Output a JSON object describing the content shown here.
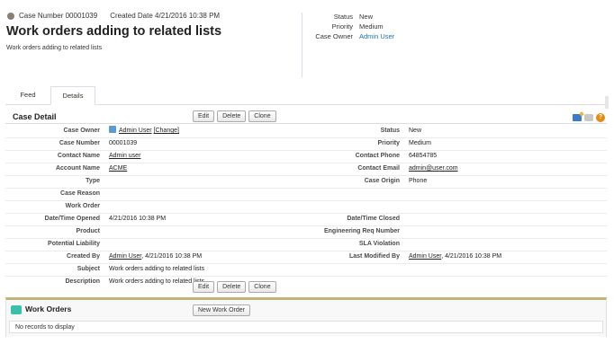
{
  "header": {
    "case_number_label": "Case Number",
    "case_number": "00001039",
    "created_date_label": "Created Date",
    "created_date": "4/21/2016 10:38 PM",
    "title": "Work orders adding to related lists",
    "subtitle": "Work orders adding to related lists",
    "fields": [
      {
        "label": "Status",
        "value": "New"
      },
      {
        "label": "Priority",
        "value": "Medium"
      },
      {
        "label": "Case Owner",
        "value": "Admin User"
      }
    ]
  },
  "tabs": [
    {
      "label": "Feed"
    },
    {
      "label": "Details"
    }
  ],
  "case_detail": {
    "title": "Case Detail",
    "buttons": {
      "edit": "Edit",
      "delete": "Delete",
      "clone": "Clone"
    },
    "help_glyph": "?",
    "rows": [
      {
        "l1": "Case Owner",
        "v1": "Admin User",
        "v1_extra": "[Change]",
        "l2": "Status",
        "v2": "New"
      },
      {
        "l1": "Case Number",
        "v1": "00001039",
        "l2": "Priority",
        "v2": "Medium"
      },
      {
        "l1": "Contact Name",
        "v1": "Admin user",
        "l2": "Contact Phone",
        "v2": "64854785"
      },
      {
        "l1": "Account Name",
        "v1": "ACME",
        "l2": "Contact Email",
        "v2": "admin@user.com"
      },
      {
        "l1": "Type",
        "v1": "",
        "l2": "Case Origin",
        "v2": "Phone"
      },
      {
        "l1": "Case Reason",
        "v1": "",
        "l2": "",
        "v2": ""
      },
      {
        "l1": "Work Order",
        "v1": "",
        "l2": "",
        "v2": ""
      },
      {
        "l1": "Date/Time Opened",
        "v1": "4/21/2016 10:38 PM",
        "l2": "Date/Time Closed",
        "v2": ""
      },
      {
        "l1": "Product",
        "v1": "",
        "l2": "Engineering Req Number",
        "v2": ""
      },
      {
        "l1": "Potential Liability",
        "v1": "",
        "l2": "SLA Violation",
        "v2": ""
      },
      {
        "l1": "Created By",
        "v1": "Admin User",
        "v1_suffix": ", 4/21/2016 10:38 PM",
        "l2": "Last Modified By",
        "v2": "Admin User",
        "v2_suffix": ", 4/21/2016 10:38 PM"
      },
      {
        "l1": "Subject",
        "v1": "Work orders adding to related lists",
        "l2": "",
        "v2": ""
      },
      {
        "l1": "Description",
        "v1": "Work orders adding to related lists",
        "l2": "",
        "v2": ""
      }
    ]
  },
  "work_orders": {
    "title": "Work Orders",
    "new_button": "New Work Order",
    "empty_text": "No records to display"
  },
  "colors": {
    "link": "#1b6fba",
    "related_list_accent": "#c5b17a",
    "work_order_icon": "#38c0a8"
  }
}
